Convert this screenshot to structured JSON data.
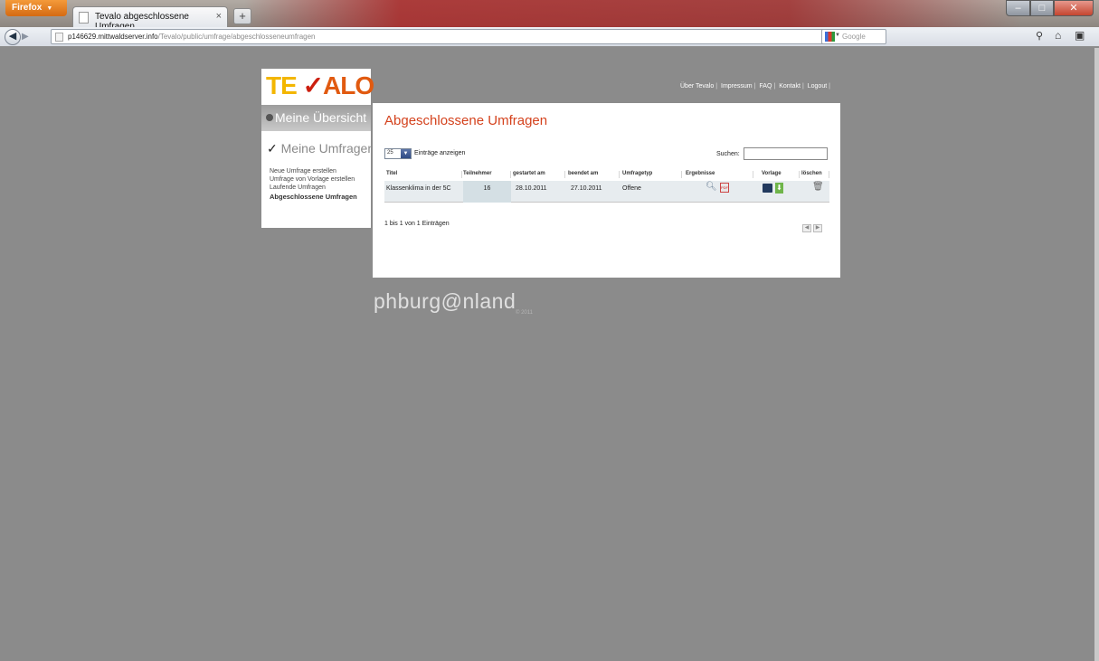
{
  "browser": {
    "menu_button": "Firefox",
    "tab_title": "Tevalo abgeschlossene Umfragen",
    "new_tab": "+",
    "url_host": "p146629.mittwaldserver.info",
    "url_path": "/Tevalo/public/umfrage/abgeschlosseneumfragen",
    "search_engine": "Google"
  },
  "header": {
    "logo_te": "TE",
    "logo_check": "✓",
    "logo_alo": "ALO",
    "nav": [
      "Über Tevalo",
      "Impressum",
      "FAQ",
      "Kontakt",
      "Logout"
    ]
  },
  "sidebar": {
    "overview": "Meine Übersicht",
    "umfragen": "Meine Umfragen",
    "links": [
      "Neue Umfrage erstellen",
      "Umfrage von Vorlage erstellen",
      "Laufende Umfragen",
      "Abgeschlossene Umfragen"
    ]
  },
  "main": {
    "title": "Abgeschlossene Umfragen",
    "length_value": "25",
    "length_label": "Einträge anzeigen",
    "search_label": "Suchen:",
    "columns": [
      "Titel",
      "Teilnehmer",
      "gestartet am",
      "beendet am",
      "Umfragetyp",
      "Ergebnisse",
      "Vorlage",
      "löschen"
    ],
    "rows": [
      {
        "titel": "Klassenklima in der 5C",
        "teilnehmer": "16",
        "gestartet": "28.10.2011",
        "beendet": "27.10.2011",
        "typ": "Offene"
      }
    ],
    "info": "1 bis 1 von 1 Einträgen"
  },
  "footer": {
    "brand": "phburg@nland",
    "copyright": "© 2011"
  },
  "colors": {
    "accent_red": "#d4421d",
    "logo_yellow": "#f3b600",
    "logo_orange": "#e15a10",
    "page_bg": "#8b8b8b"
  }
}
